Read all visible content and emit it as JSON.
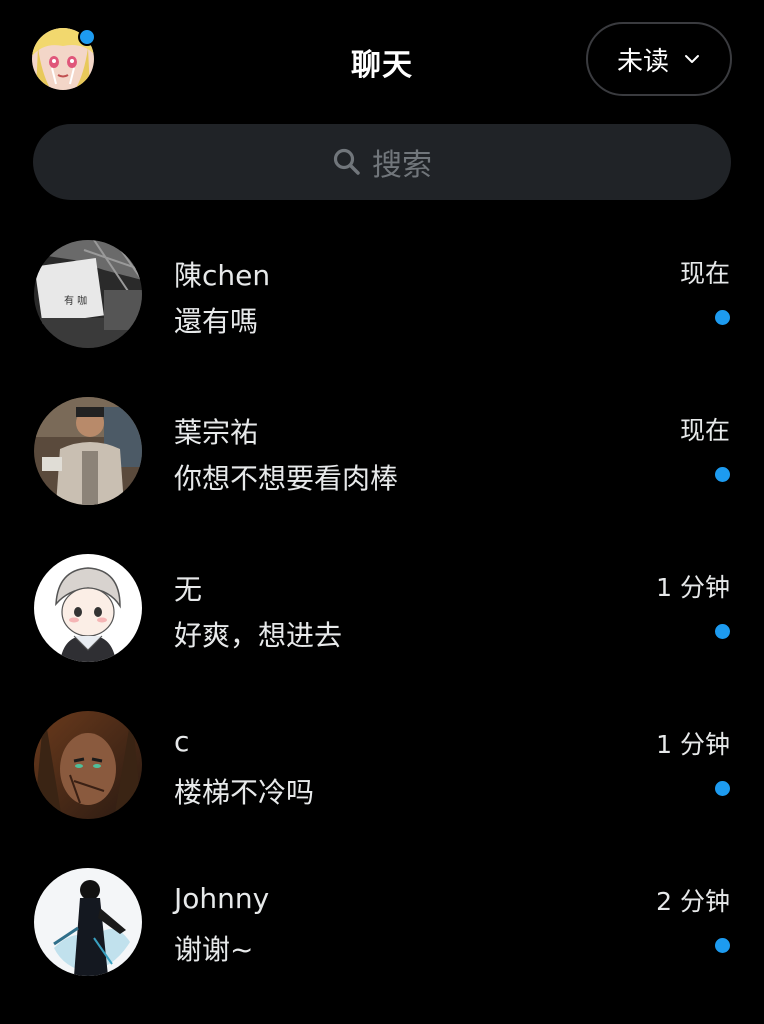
{
  "header": {
    "title": "聊天",
    "filter_label": "未读",
    "me_avatar_icon": "user-avatar",
    "online_dot_color": "#1d9bf0"
  },
  "search": {
    "placeholder": "搜索",
    "icon": "search-icon"
  },
  "accent_color": "#1d9bf0",
  "conversations": [
    {
      "name": "陳chen",
      "message": "還有嗎",
      "time": "现在",
      "unread": true
    },
    {
      "name": "葉宗祐",
      "message": "你想不想要看肉棒",
      "time": "现在",
      "unread": true
    },
    {
      "name": "无",
      "message": "好爽，想进去",
      "time": "1 分钟",
      "unread": true
    },
    {
      "name": "c",
      "message": "楼梯不冷吗",
      "time": "1 分钟",
      "unread": true
    },
    {
      "name": "Johnny",
      "message": "谢谢~",
      "time": "2 分钟",
      "unread": true
    }
  ]
}
